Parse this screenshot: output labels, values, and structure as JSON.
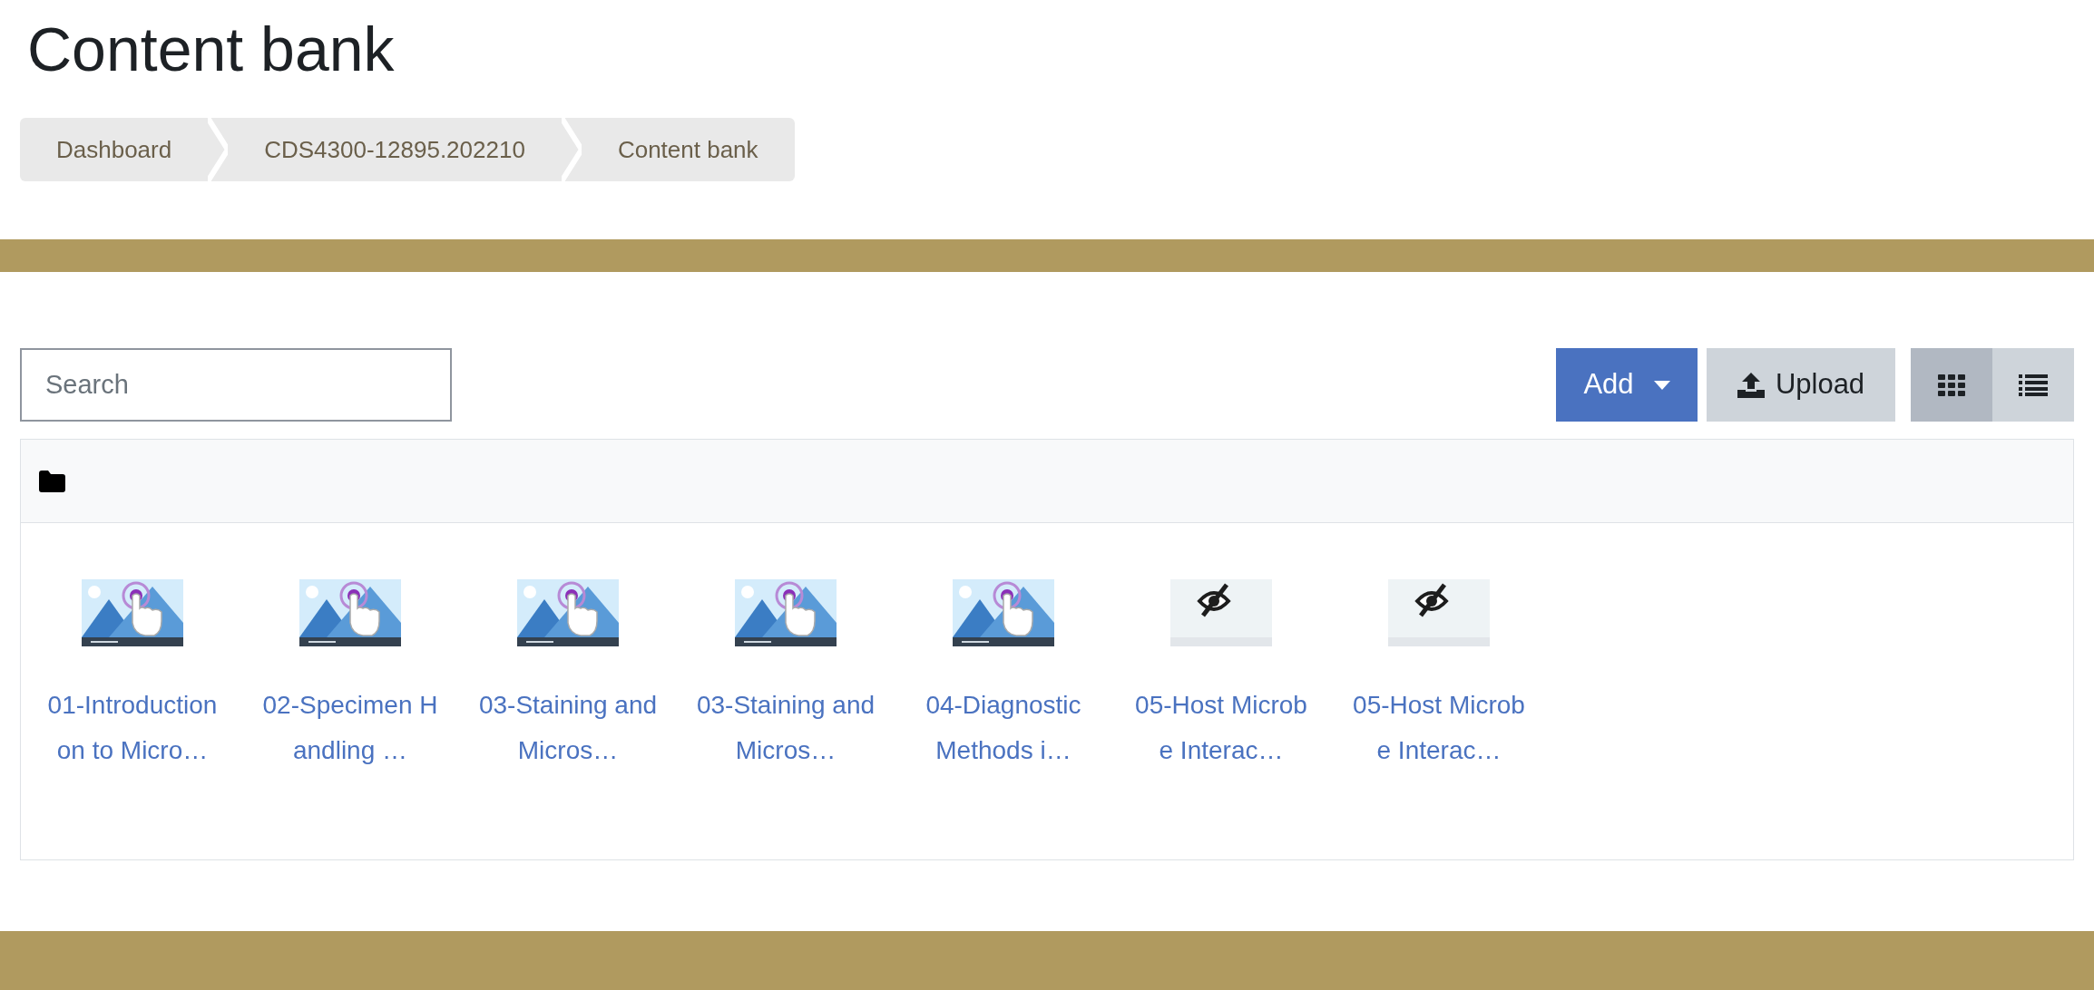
{
  "page": {
    "title": "Content bank"
  },
  "breadcrumb": [
    {
      "label": "Dashboard"
    },
    {
      "label": "CDS4300-12895.202210"
    },
    {
      "label": "Content bank"
    }
  ],
  "search": {
    "placeholder": "Search"
  },
  "toolbar": {
    "add_label": "Add",
    "upload_label": "Upload"
  },
  "view_toggle": [
    {
      "kind": "grid",
      "selected": true
    },
    {
      "kind": "list",
      "selected": false
    }
  ],
  "items": [
    {
      "kind": "interactive",
      "name": "01-Introduction on to Micro…"
    },
    {
      "kind": "interactive",
      "name": "02-Specimen Handling …"
    },
    {
      "kind": "interactive",
      "name": "03-Staining and Micros…"
    },
    {
      "kind": "interactive",
      "name": "03-Staining and Micros…"
    },
    {
      "kind": "interactive",
      "name": "04-Diagnostic Methods i…"
    },
    {
      "kind": "hidden",
      "name": "05-Host Microbe Interac…"
    },
    {
      "kind": "hidden",
      "name": "05-Host Microbe Interac…"
    }
  ]
}
